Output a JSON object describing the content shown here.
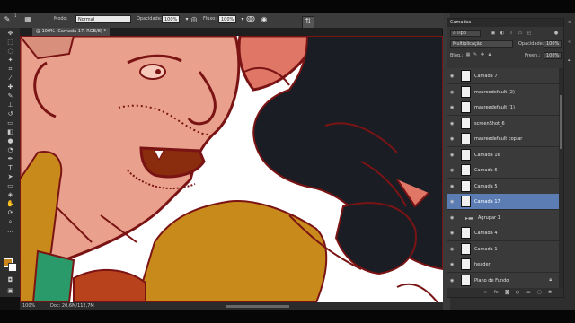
{
  "options_bar": {
    "mode_label": "Modo:",
    "mode_value": "Normal",
    "opacity_label": "Opacidade:",
    "opacity_value": "100%",
    "flow_label": "Fluxo:",
    "flow_value": "100%",
    "brush_size": "1"
  },
  "document": {
    "tab_label": "@ 100% (Camada 17, RGB/8) *",
    "zoom": "100%",
    "doc_info": "Doc: 20,6M/112,7M"
  },
  "layers_panel": {
    "title": "Camadas",
    "filter_label": "Tipo",
    "blend_mode": "Multiplicação",
    "opacity_label": "Opacidade:",
    "opacity_value": "100%",
    "lock_label": "Bloq.:",
    "fill_label": "Preen.:",
    "fill_value": "100%",
    "layers": [
      {
        "name": "Camada 7",
        "active": false,
        "group": false,
        "locked": false
      },
      {
        "name": "masreedefault (2)",
        "active": false,
        "group": false,
        "locked": false
      },
      {
        "name": "masreedefault (1)",
        "active": false,
        "group": false,
        "locked": false
      },
      {
        "name": "screenShot_6",
        "active": false,
        "group": false,
        "locked": false
      },
      {
        "name": "masreedefault copiar",
        "active": false,
        "group": false,
        "locked": false
      },
      {
        "name": "Camada 16",
        "active": false,
        "group": false,
        "locked": false
      },
      {
        "name": "Camada 6",
        "active": false,
        "group": false,
        "locked": false
      },
      {
        "name": "Camada 5",
        "active": false,
        "group": false,
        "locked": false
      },
      {
        "name": "Camada 17",
        "active": true,
        "group": false,
        "locked": false
      },
      {
        "name": "Agrupar 1",
        "active": false,
        "group": true,
        "locked": false
      },
      {
        "name": "Camada 4",
        "active": false,
        "group": false,
        "locked": false
      },
      {
        "name": "Camada 1",
        "active": false,
        "group": false,
        "locked": false
      },
      {
        "name": "header",
        "active": false,
        "group": false,
        "locked": false
      },
      {
        "name": "Plano de Fundo",
        "active": false,
        "group": false,
        "locked": true
      }
    ],
    "footer_icons": [
      "link-icon",
      "fx-icon",
      "mask-icon",
      "adjustment-icon",
      "folder-icon",
      "new-layer-icon",
      "trash-icon"
    ]
  },
  "colors": {
    "foreground": "#c8871e",
    "background": "#ffffff",
    "line_art": "#7a1414",
    "skin": "#e9a08c",
    "jacket": "#c98a1c",
    "beard": "#b8421c",
    "shadow_figure": "#1a1d24",
    "shirt": "#2a9a6a",
    "active_layer": "#5b7db3"
  }
}
